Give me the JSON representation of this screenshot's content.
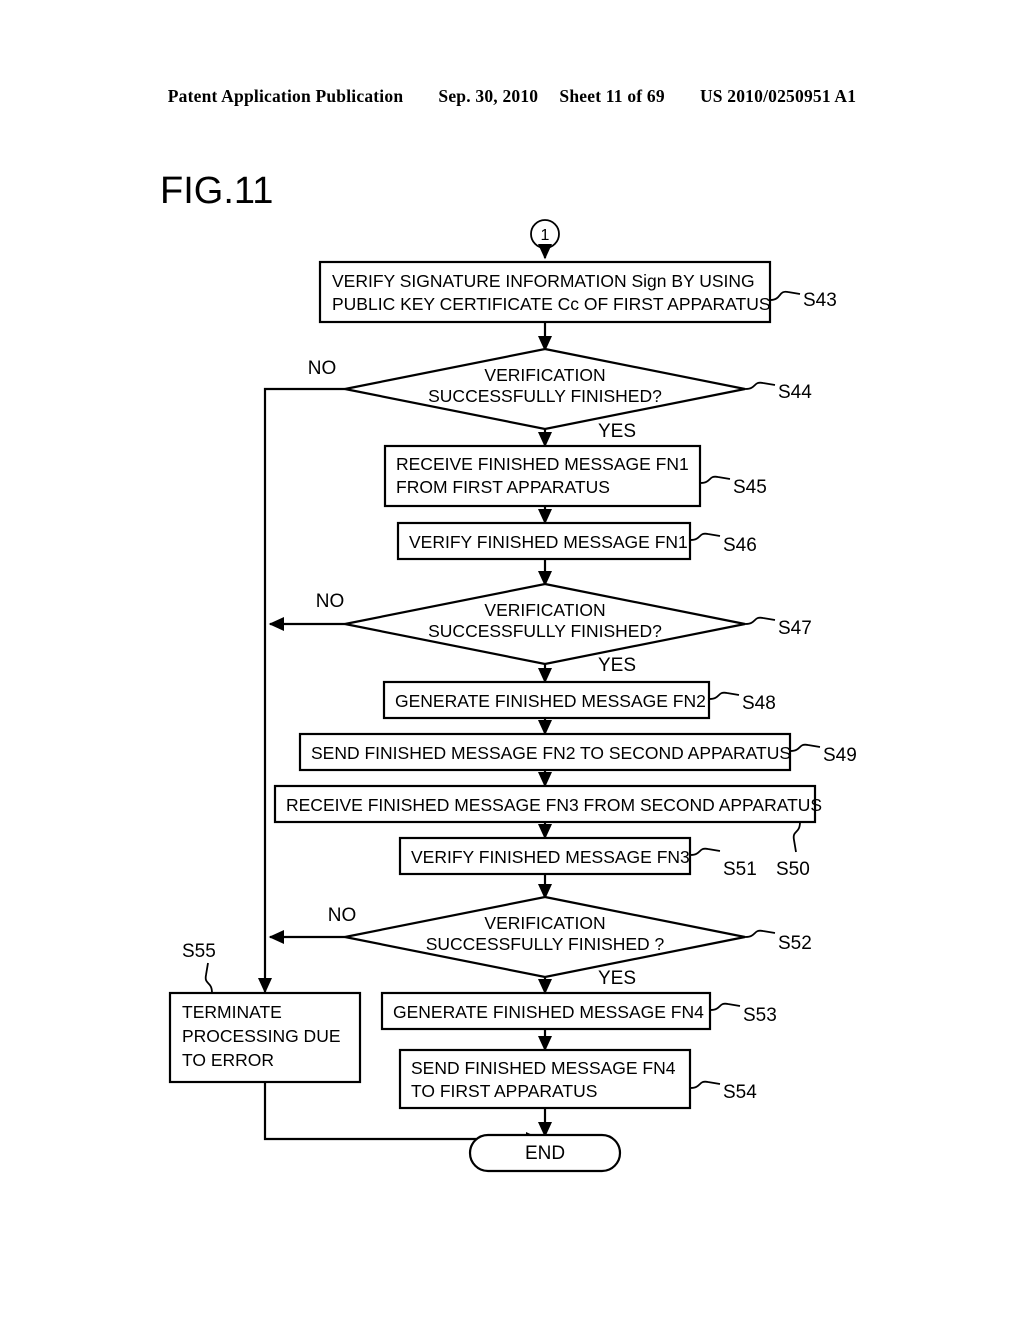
{
  "header": {
    "publication": "Patent Application Publication",
    "date": "Sep. 30, 2010",
    "sheet": "Sheet 11 of 69",
    "patent_number": "US 2010/0250951 A1"
  },
  "figure": {
    "title": "FIG.11",
    "connector_in": "1",
    "end_label": "END"
  },
  "labels": {
    "yes": "YES",
    "no": "NO"
  },
  "steps": {
    "s43": {
      "id": "S43",
      "line1": "VERIFY SIGNATURE INFORMATION Sign BY USING",
      "line2": "PUBLIC KEY CERTIFICATE Cc OF FIRST APPARATUS"
    },
    "s44": {
      "id": "S44",
      "line1": "VERIFICATION",
      "line2": "SUCCESSFULLY FINISHED?"
    },
    "s45": {
      "id": "S45",
      "line1": "RECEIVE FINISHED MESSAGE FN1",
      "line2": "FROM FIRST APPARATUS"
    },
    "s46": {
      "id": "S46",
      "line1": "VERIFY FINISHED MESSAGE FN1"
    },
    "s47": {
      "id": "S47",
      "line1": "VERIFICATION",
      "line2": "SUCCESSFULLY FINISHED?"
    },
    "s48": {
      "id": "S48",
      "line1": "GENERATE FINISHED MESSAGE FN2"
    },
    "s49": {
      "id": "S49",
      "line1": "SEND FINISHED MESSAGE FN2 TO SECOND APPARATUS"
    },
    "s50": {
      "id": "S50",
      "line1": "RECEIVE FINISHED MESSAGE FN3 FROM SECOND APPARATUS"
    },
    "s51": {
      "id": "S51",
      "line1": "VERIFY FINISHED MESSAGE FN3"
    },
    "s52": {
      "id": "S52",
      "line1": "VERIFICATION",
      "line2": "SUCCESSFULLY FINISHED ?"
    },
    "s53": {
      "id": "S53",
      "line1": "GENERATE FINISHED MESSAGE FN4"
    },
    "s54": {
      "id": "S54",
      "line1": "SEND FINISHED MESSAGE FN4",
      "line2": "TO FIRST APPARATUS"
    },
    "s55": {
      "id": "S55",
      "line1": "TERMINATE",
      "line2": "PROCESSING DUE",
      "line3": "TO ERROR"
    }
  }
}
